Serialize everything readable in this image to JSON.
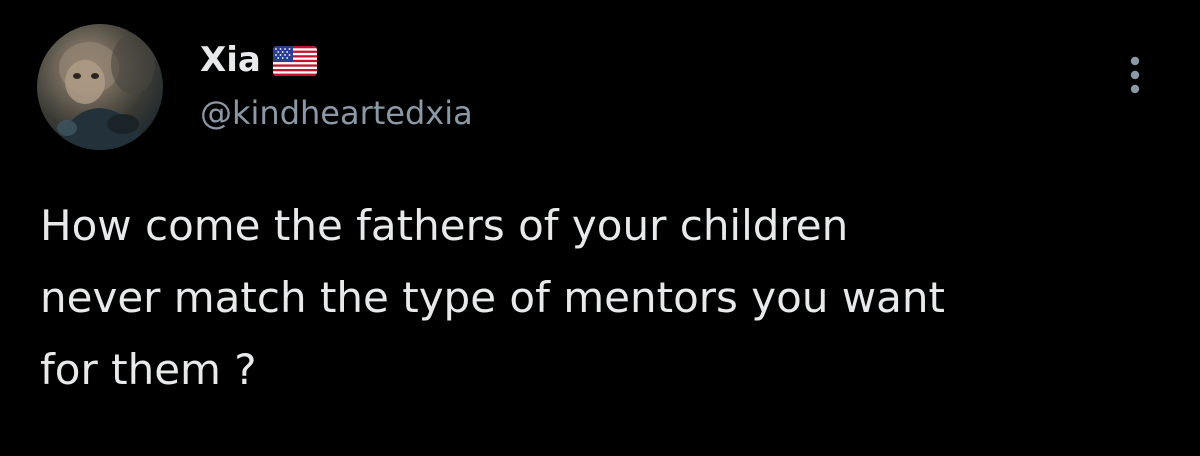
{
  "author": {
    "display_name": "Xia",
    "handle": "@kindheartedxia",
    "flag_icon": "us-flag-icon",
    "avatar_icon": "profile-photo"
  },
  "tweet": {
    "text": "How come the fathers of your children\nnever match the type of mentors you want\nfor them ?"
  },
  "actions": {
    "more_icon": "more-vertical-icon"
  },
  "colors": {
    "background": "#000000",
    "primary_text": "#e7e9ea",
    "secondary_text": "#8b98a5"
  }
}
